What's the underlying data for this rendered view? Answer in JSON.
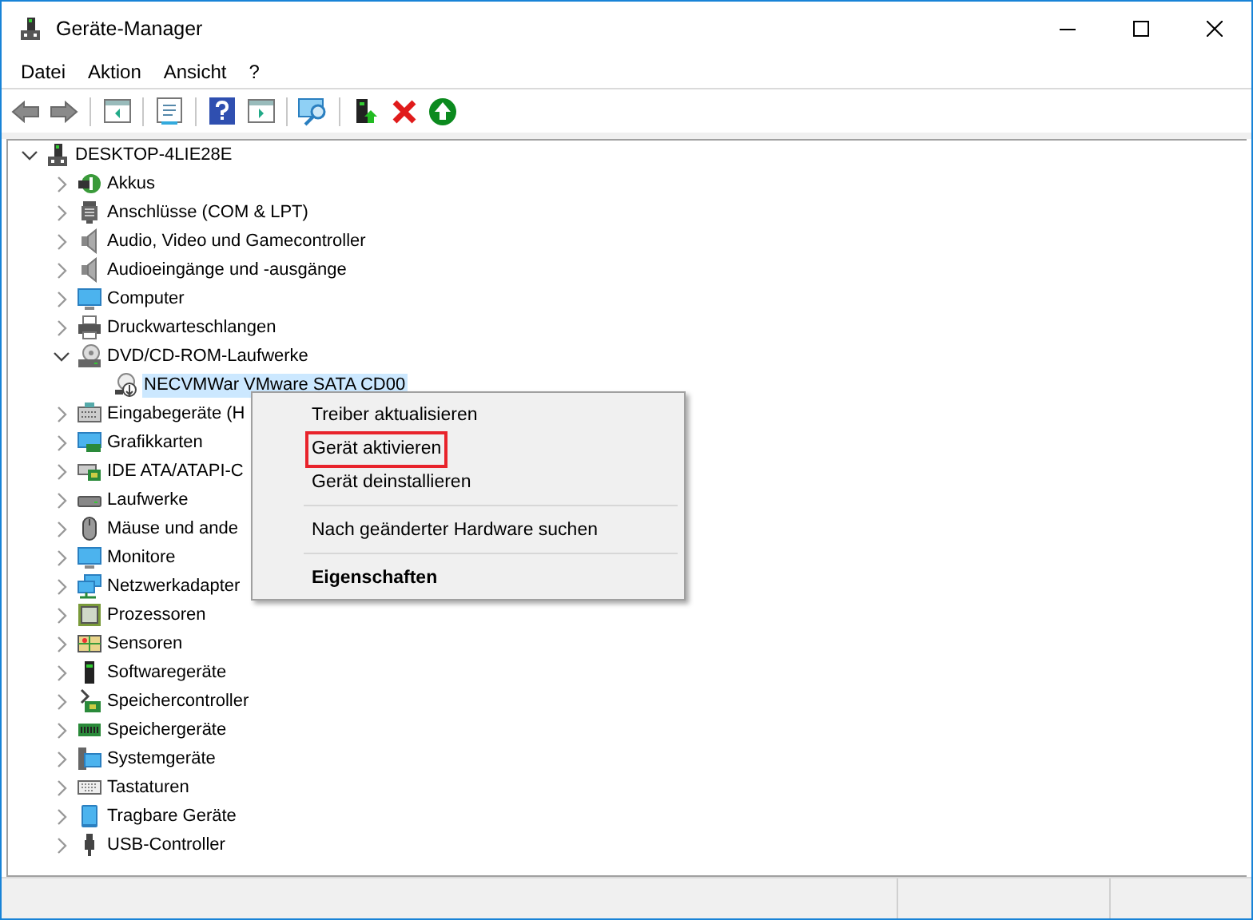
{
  "window": {
    "title": "Geräte-Manager"
  },
  "menu_bar": [
    "Datei",
    "Aktion",
    "Ansicht",
    "?"
  ],
  "tree": [
    {
      "label": "DESKTOP-4LIE28E",
      "expanded": true,
      "selected": false,
      "children": [
        {
          "label": "Akkus",
          "expanded": false,
          "selected": false
        },
        {
          "label": "Anschlüsse (COM & LPT)",
          "expanded": false,
          "selected": false
        },
        {
          "label": "Audio, Video und Gamecontroller",
          "expanded": false,
          "selected": false
        },
        {
          "label": "Audioeingänge und -ausgänge",
          "expanded": false,
          "selected": false
        },
        {
          "label": "Computer",
          "expanded": false,
          "selected": false
        },
        {
          "label": "Druckwarteschlangen",
          "expanded": false,
          "selected": false
        },
        {
          "label": "DVD/CD-ROM-Laufwerke",
          "expanded": true,
          "selected": false,
          "children": [
            {
              "label": "NECVMWar VMware SATA CD00",
              "selected": true
            }
          ]
        },
        {
          "label": "Eingabegeräte (H",
          "expanded": false,
          "selected": false
        },
        {
          "label": "Grafikkarten",
          "expanded": false,
          "selected": false
        },
        {
          "label": "IDE ATA/ATAPI-C",
          "expanded": false,
          "selected": false
        },
        {
          "label": "Laufwerke",
          "expanded": false,
          "selected": false
        },
        {
          "label": "Mäuse und ande",
          "expanded": false,
          "selected": false
        },
        {
          "label": "Monitore",
          "expanded": false,
          "selected": false
        },
        {
          "label": "Netzwerkadapter",
          "expanded": false,
          "selected": false
        },
        {
          "label": "Prozessoren",
          "expanded": false,
          "selected": false
        },
        {
          "label": "Sensoren",
          "expanded": false,
          "selected": false
        },
        {
          "label": "Softwaregeräte",
          "expanded": false,
          "selected": false
        },
        {
          "label": "Speichercontroller",
          "expanded": false,
          "selected": false
        },
        {
          "label": "Speichergeräte",
          "expanded": false,
          "selected": false
        },
        {
          "label": "Systemgeräte",
          "expanded": false,
          "selected": false
        },
        {
          "label": "Tastaturen",
          "expanded": false,
          "selected": false
        },
        {
          "label": "Tragbare Geräte",
          "expanded": false,
          "selected": false
        },
        {
          "label": "USB-Controller",
          "expanded": false,
          "selected": false
        }
      ]
    }
  ],
  "context_menu": [
    {
      "kind": "item",
      "label": "Treiber aktualisieren",
      "highlighted": false,
      "default": false
    },
    {
      "kind": "item",
      "label": "Gerät aktivieren",
      "highlighted": true,
      "default": false
    },
    {
      "kind": "item",
      "label": "Gerät deinstallieren",
      "highlighted": false,
      "default": false
    },
    {
      "kind": "separator"
    },
    {
      "kind": "item",
      "label": "Nach geänderter Hardware suchen",
      "highlighted": false,
      "default": false
    },
    {
      "kind": "separator"
    },
    {
      "kind": "item",
      "label": "Eigenschaften",
      "highlighted": false,
      "default": true
    }
  ]
}
